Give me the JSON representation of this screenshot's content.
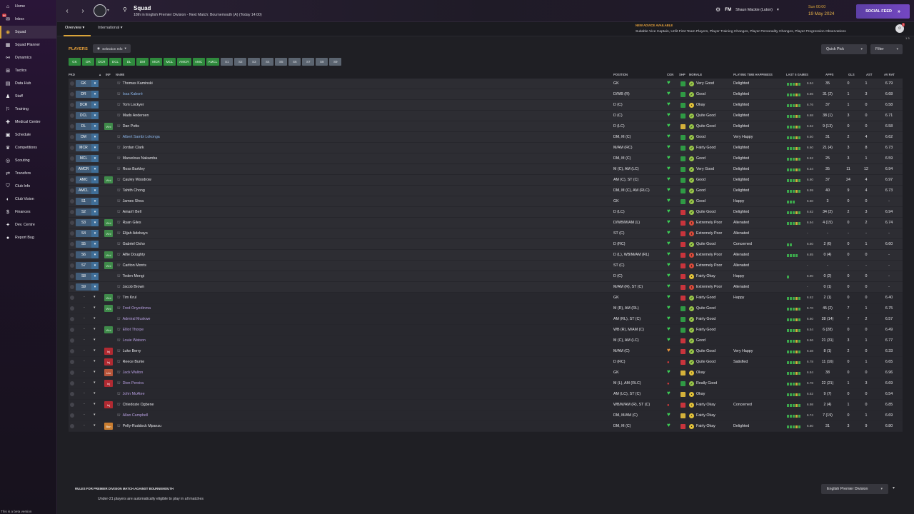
{
  "sidebar": {
    "items": [
      {
        "label": "Home",
        "icon": "home-icon",
        "glyph": "⌂"
      },
      {
        "label": "Inbox",
        "icon": "inbox-icon",
        "glyph": "✉",
        "badge": "86"
      },
      {
        "label": "Squad",
        "icon": "squad-icon",
        "glyph": "◉",
        "active": true
      },
      {
        "label": "Squad Planner",
        "icon": "planner-icon",
        "glyph": "▦"
      },
      {
        "label": "Dynamics",
        "icon": "dynamics-icon",
        "glyph": "⚯"
      },
      {
        "label": "Tactics",
        "icon": "tactics-icon",
        "glyph": "⊞"
      },
      {
        "label": "Data Hub",
        "icon": "data-hub-icon",
        "glyph": "▤"
      },
      {
        "label": "Staff",
        "icon": "staff-icon",
        "glyph": "♟"
      },
      {
        "label": "Training",
        "icon": "training-icon",
        "glyph": "⚐"
      },
      {
        "label": "Medical Centre",
        "icon": "medical-icon",
        "glyph": "✚"
      },
      {
        "label": "Schedule",
        "icon": "schedule-icon",
        "glyph": "▣"
      },
      {
        "label": "Competitions",
        "icon": "trophy-icon",
        "glyph": "♛"
      },
      {
        "label": "Scouting",
        "icon": "scouting-icon",
        "glyph": "◎"
      },
      {
        "label": "Transfers",
        "icon": "transfers-icon",
        "glyph": "⇄"
      },
      {
        "label": "Club Info",
        "icon": "club-info-icon",
        "glyph": "⛉"
      },
      {
        "label": "Club Vision",
        "icon": "club-vision-icon",
        "glyph": "◐"
      },
      {
        "label": "Finances",
        "icon": "finances-icon",
        "glyph": "$"
      },
      {
        "label": "Dev. Centre",
        "icon": "dev-centre-icon",
        "glyph": "✦"
      },
      {
        "label": "Report Bug",
        "icon": "bug-icon",
        "glyph": "●"
      }
    ],
    "beta_note": "This is a beta version"
  },
  "topbar": {
    "title": "Squad",
    "subtitle": "18th in English Premier Division - Next Match: Bournemouth (A) (Today 14:00)",
    "fm_logo": "FM",
    "manager": "Shaun Mackie (Luton)",
    "time": "Sun 00:00",
    "date": "19 May 2024",
    "social_feed": "SOCIAL FEED"
  },
  "subbar": {
    "tabs": [
      "Overview",
      "International"
    ],
    "advice_title": "NEW ADVICE AVAILABLE",
    "advice_text": "Suitable Vice Captain, Unfit First Team Players, Player Training Changes, Player Personality Changes, Player Progression Observations",
    "notif_badge": "7",
    "tiny_count": "1 3"
  },
  "panel": {
    "players_label": "PLAYERS",
    "selection_info": "Selection Info",
    "quick_pick": "Quick Pick",
    "filter": "Filter",
    "chips_main": [
      "GK",
      "DR",
      "DCR",
      "DCL",
      "DL",
      "DM",
      "MCR",
      "MCL",
      "AMCR",
      "AMC",
      "AMCL"
    ],
    "chips_subs": [
      "S1",
      "S2",
      "S3",
      "S4",
      "S5",
      "S6",
      "S7",
      "S8",
      "S9"
    ],
    "headers": {
      "pkd": "PKD",
      "inf": "INF",
      "name": "NAME",
      "position": "POSITION",
      "con": "CON",
      "shp": "SHP",
      "morale": "MORALE",
      "pth": "PLAYING TIME HAPPINESS",
      "l5": "LAST 5 GAMES",
      "apps": "APPS",
      "gls": "GLS",
      "ast": "AST",
      "avrat": "AV RAT"
    }
  },
  "colors": {
    "accent": "#d9a43a",
    "social": "#7447c2",
    "chip_green": "#2f8a3d"
  },
  "players": [
    {
      "slot": "GK",
      "name": "Thomas Kaminski",
      "pos": "GK",
      "con": "hi",
      "shp": "g",
      "mor": "Very Good",
      "mc": "g",
      "pth": "Delighted",
      "form": "gggyg",
      "l5": "6.84",
      "apps": "35",
      "gls": "0",
      "ast": "1",
      "rat": "6.79"
    },
    {
      "slot": "DR",
      "name": "Issa Kaboré",
      "link": "link",
      "pos": "D/WB (R)",
      "con": "hi",
      "shp": "g",
      "mor": "Good",
      "mc": "g",
      "pth": "Delighted",
      "form": "gggyg",
      "l5": "6.86",
      "apps": "31 (2)",
      "gls": "1",
      "ast": "3",
      "rat": "6.68"
    },
    {
      "slot": "DCR",
      "name": "Tom Lockyer",
      "pos": "D (C)",
      "con": "hi",
      "shp": "g",
      "mor": "Okay",
      "mc": "y",
      "pth": "Delighted",
      "form": "gggyg",
      "l5": "6.76",
      "apps": "37",
      "gls": "1",
      "ast": "0",
      "rat": "6.58"
    },
    {
      "slot": "DCL",
      "name": "Mads Andersen",
      "pos": "D (C)",
      "con": "hi",
      "shp": "g",
      "mor": "Quite Good",
      "mc": "g",
      "pth": "Delighted",
      "form": "gggyg",
      "l5": "6.68",
      "apps": "38 (1)",
      "gls": "3",
      "ast": "0",
      "rat": "6.71"
    },
    {
      "slot": "DL",
      "inf": "Wnt",
      "name": "Dan Potts",
      "pos": "D (LC)",
      "con": "hi",
      "shp": "y",
      "mor": "Quite Good",
      "mc": "g",
      "pth": "Delighted",
      "form": "gggyg",
      "l5": "6.62",
      "apps": "9 (13)",
      "gls": "0",
      "ast": "0",
      "rat": "6.58"
    },
    {
      "slot": "DM",
      "name": "Albert Sambi Lokonga",
      "link": "link",
      "pos": "DM, M (C)",
      "con": "hi",
      "shp": "g",
      "mor": "Good",
      "mc": "g",
      "pth": "Very Happy",
      "form": "gggyg",
      "l5": "6.50",
      "apps": "31",
      "gls": "2",
      "ast": "4",
      "rat": "6.62"
    },
    {
      "slot": "MCR",
      "name": "Jordan Clark",
      "pos": "M/AM (RC)",
      "con": "hi",
      "shp": "g",
      "mor": "Fairly Good",
      "mc": "g",
      "pth": "Delighted",
      "form": "gggyg",
      "l5": "6.60",
      "apps": "21 (4)",
      "gls": "3",
      "ast": "8",
      "rat": "6.73"
    },
    {
      "slot": "MCL",
      "name": "Marvelous Nakamba",
      "pos": "DM, M (C)",
      "con": "hi",
      "shp": "g",
      "mor": "Good",
      "mc": "g",
      "pth": "Delighted",
      "form": "gggyg",
      "l5": "6.52",
      "apps": "25",
      "gls": "3",
      "ast": "1",
      "rat": "6.59"
    },
    {
      "slot": "AMCR",
      "name": "Ross Barkley",
      "pos": "M (C), AM (LC)",
      "con": "hi",
      "shp": "g",
      "mor": "Very Good",
      "mc": "g",
      "pth": "Delighted",
      "form": "gggyg",
      "l5": "6.34",
      "apps": "35",
      "gls": "11",
      "ast": "12",
      "rat": "6.94"
    },
    {
      "slot": "AMC",
      "inf": "Wnt",
      "name": "Cauley Woodrow",
      "pos": "AM (C), ST (C)",
      "con": "hi",
      "shp": "g",
      "mor": "Good",
      "mc": "g",
      "pth": "Delighted",
      "form": "gggyg",
      "l5": "6.80",
      "apps": "37",
      "gls": "24",
      "ast": "4",
      "rat": "6.97"
    },
    {
      "slot": "AMCL",
      "name": "Tahith Chong",
      "pos": "DM, M (C), AM (RLC)",
      "con": "hi",
      "shp": "g",
      "mor": "Good",
      "mc": "g",
      "pth": "Delighted",
      "form": "gggyg",
      "l5": "6.99",
      "apps": "40",
      "gls": "9",
      "ast": "4",
      "rat": "6.73"
    },
    {
      "slot": "S1",
      "name": "James Shea",
      "pos": "GK",
      "con": "hi",
      "shp": "g",
      "mor": "Good",
      "mc": "g",
      "pth": "Happy",
      "form": "ggg",
      "l5": "6.50",
      "apps": "3",
      "gls": "0",
      "ast": "0",
      "rat": "-"
    },
    {
      "slot": "S2",
      "name": "Amari'i Bell",
      "pos": "D (LC)",
      "con": "hi",
      "shp": "r",
      "mor": "Quite Good",
      "mc": "g",
      "pth": "Delighted",
      "form": "gggyg",
      "l5": "6.82",
      "apps": "34 (2)",
      "gls": "2",
      "ast": "3",
      "rat": "6.94"
    },
    {
      "slot": "S3",
      "inf": "Wnt",
      "name": "Ryan Giles",
      "pos": "D/WB/M/AM (L)",
      "con": "hi",
      "shp": "r",
      "mor": "Extremely Poor",
      "mc": "r",
      "pth": "Alienated",
      "form": "gggyg",
      "l5": "6.94",
      "apps": "4 (15)",
      "gls": "0",
      "ast": "2",
      "rat": "6.74"
    },
    {
      "slot": "S4",
      "inf": "Wnt",
      "name": "Elijah Adebayo",
      "pos": "ST (C)",
      "con": "hi",
      "shp": "r",
      "mor": "Extremely Poor",
      "mc": "r",
      "pth": "Alienated",
      "form": "",
      "l5": "-",
      "apps": "-",
      "gls": "-",
      "ast": "-",
      "rat": "-"
    },
    {
      "slot": "S5",
      "name": "Gabriel Osho",
      "pos": "D (RC)",
      "con": "hi",
      "shp": "r",
      "mor": "Quite Good",
      "mc": "g",
      "pth": "Concerned",
      "form": "gg",
      "l5": "6.60",
      "apps": "2 (6)",
      "gls": "0",
      "ast": "1",
      "rat": "6.60"
    },
    {
      "slot": "S6",
      "inf": "Wnt",
      "name": "Alfie Doughty",
      "pos": "D (L), WB/M/AM (RL)",
      "con": "hi",
      "shp": "r",
      "mor": "Extremely Poor",
      "mc": "r",
      "pth": "Alienated",
      "form": "gggg",
      "l5": "6.85",
      "apps": "0 (4)",
      "gls": "0",
      "ast": "0",
      "rat": "-"
    },
    {
      "slot": "S7",
      "inf": "Wnt",
      "name": "Carlton Morris",
      "pos": "ST (C)",
      "con": "hi",
      "shp": "r",
      "mor": "Extremely Poor",
      "mc": "r",
      "pth": "Alienated",
      "form": "",
      "l5": "-",
      "apps": "-",
      "gls": "-",
      "ast": "-",
      "rat": "-"
    },
    {
      "slot": "S8",
      "name": "Teden Mengi",
      "pos": "D (C)",
      "con": "hi",
      "shp": "r",
      "mor": "Fairly Okay",
      "mc": "y",
      "pth": "Happy",
      "form": "g",
      "l5": "6.90",
      "apps": "0 (2)",
      "gls": "0",
      "ast": "0",
      "rat": "-"
    },
    {
      "slot": "S9",
      "name": "Jacob Brown",
      "pos": "M/AM (R), ST (C)",
      "con": "hi",
      "shp": "r",
      "mor": "Extremely Poor",
      "mc": "r",
      "pth": "Alienated",
      "form": "",
      "l5": "-",
      "apps": "0 (1)",
      "gls": "0",
      "ast": "0",
      "rat": "-"
    },
    {
      "res": true,
      "inf": "Wnt",
      "name": "Tim Krul",
      "pos": "GK",
      "con": "hi",
      "shp": "r",
      "mor": "Fairly Good",
      "mc": "g",
      "pth": "Happy",
      "form": "gggyg",
      "l5": "6.62",
      "apps": "2 (1)",
      "gls": "0",
      "ast": "0",
      "rat": "6.40"
    },
    {
      "res": true,
      "inf": "Wnt",
      "name": "Fred Onyedinma",
      "link": "loan",
      "pos": "M (R), AM (RL)",
      "con": "hi",
      "shp": "g",
      "mor": "Quite Good",
      "mc": "g",
      "pth": "",
      "form": "gggyg",
      "l5": "6.70",
      "apps": "45 (2)",
      "gls": "7",
      "ast": "1",
      "rat": "6.75"
    },
    {
      "res": true,
      "name": "Admiral Muskwe",
      "link": "loan",
      "pos": "AM (RL), ST (C)",
      "con": "hi",
      "shp": "g",
      "mor": "Fairly Good",
      "mc": "g",
      "pth": "",
      "form": "gggyg",
      "l5": "6.60",
      "apps": "28 (14)",
      "gls": "7",
      "ast": "2",
      "rat": "6.57"
    },
    {
      "res": true,
      "inf": "Wnt",
      "name": "Elliot Thorpe",
      "link": "loan",
      "pos": "WB (R), M/AM (C)",
      "con": "hi",
      "shp": "g",
      "mor": "Fairly Good",
      "mc": "g",
      "pth": "",
      "form": "gggyg",
      "l5": "6.54",
      "apps": "6 (28)",
      "gls": "0",
      "ast": "0",
      "rat": "6.49"
    },
    {
      "res": true,
      "name": "Louie Watson",
      "link": "loan",
      "pos": "M (C), AM (LC)",
      "con": "hi",
      "shp": "r",
      "mor": "Good",
      "mc": "g",
      "pth": "",
      "form": "gggyg",
      "l5": "6.66",
      "apps": "21 (31)",
      "gls": "3",
      "ast": "1",
      "rat": "6.77"
    },
    {
      "res": true,
      "inf": "Inj",
      "name": "Luke Berry",
      "pos": "M/AM (C)",
      "con": "mid",
      "shp": "r",
      "mor": "Quite Good",
      "mc": "g",
      "pth": "Very Happy",
      "form": "gggyg",
      "l5": "6.38",
      "apps": "8 (1)",
      "gls": "2",
      "ast": "0",
      "rat": "6.33"
    },
    {
      "res": true,
      "inf": "Inj",
      "name": "Reece Burke",
      "pos": "D (RC)",
      "con": "low",
      "shp": "r",
      "mor": "Quite Good",
      "mc": "g",
      "pth": "Satisfied",
      "form": "gggyg",
      "l5": "6.78",
      "apps": "11 (16)",
      "gls": "0",
      "ast": "1",
      "rat": "6.65"
    },
    {
      "res": true,
      "inf": "Unr",
      "name": "Jack Walton",
      "link": "loan",
      "pos": "GK",
      "con": "hi",
      "shp": "y",
      "mor": "Okay",
      "mc": "y",
      "pth": "",
      "form": "gggyg",
      "l5": "6.84",
      "apps": "38",
      "gls": "0",
      "ast": "0",
      "rat": "6.96"
    },
    {
      "res": true,
      "inf": "Inj",
      "name": "Dion Pereira",
      "link": "loan",
      "pos": "M (L), AM (RLC)",
      "con": "low",
      "shp": "g",
      "mor": "Really Good",
      "mc": "g",
      "pth": "",
      "form": "gggyg",
      "l5": "6.78",
      "apps": "22 (21)",
      "gls": "1",
      "ast": "3",
      "rat": "6.69"
    },
    {
      "res": true,
      "name": "John McAtee",
      "link": "loan",
      "pos": "AM (LC), ST (C)",
      "con": "hi",
      "shp": "y",
      "mor": "Okay",
      "mc": "y",
      "pth": "",
      "form": "gggyg",
      "l5": "6.52",
      "apps": "9 (7)",
      "gls": "0",
      "ast": "0",
      "rat": "6.54"
    },
    {
      "res": true,
      "inf": "Inj",
      "name": "Chiedozie Ogbene",
      "pos": "WB/M/AM (R), ST (C)",
      "con": "low",
      "shp": "r",
      "mor": "Fairly Okay",
      "mc": "y",
      "pth": "Concerned",
      "form": "gggyg",
      "l5": "6.98",
      "apps": "2 (4)",
      "gls": "1",
      "ast": "0",
      "rat": "6.85"
    },
    {
      "res": true,
      "name": "Allan Campbell",
      "link": "loan",
      "pos": "DM, M/AM (C)",
      "con": "hi",
      "shp": "y",
      "mor": "Fairly Okay",
      "mc": "y",
      "pth": "",
      "form": "gggyg",
      "l5": "6.74",
      "apps": "7 (19)",
      "gls": "0",
      "ast": "1",
      "rat": "6.69"
    },
    {
      "res": true,
      "inf": "Ban",
      "name": "Pelly-Ruddock Mpanzu",
      "pos": "DM, M (C)",
      "con": "hi",
      "shp": "r",
      "mor": "Fairly Okay",
      "mc": "y",
      "pth": "Delighted",
      "form": "gggyg",
      "l5": "6.80",
      "apps": "31",
      "gls": "3",
      "ast": "9",
      "rat": "6.80"
    }
  ],
  "bottom": {
    "rules_title": "RULES FOR PREMIER DIVISION MATCH AGAINST BOURNEMOUTH",
    "rules_text": "Under-21 players are automatically eligible to play in all matches",
    "league": "English Premier Division"
  }
}
